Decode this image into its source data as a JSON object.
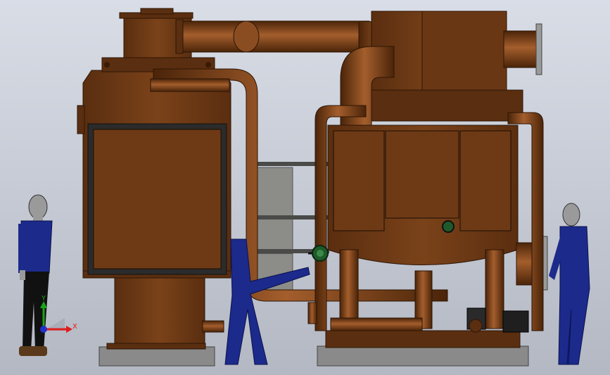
{
  "viewport": {
    "background_top": "#d9dde6",
    "background_bottom": "#b3b8c3"
  },
  "colors": {
    "equipment": "#6e3a16",
    "equipment_dark": "#3f1f08",
    "equipment_light": "#8a4d22",
    "pipe_highlight": "#a45e2c",
    "panel_frame": "#2a2a2a",
    "slab": "#8a8a8a",
    "person_blue": "#1c2a8c",
    "person_skin": "#9a9a9a",
    "person_pants": "#111111",
    "valve_green": "#1f5a2a",
    "heat_exchanger": "#8c8c88"
  },
  "coordinate_triad": {
    "icon": "xyz-axis-triad-icon",
    "x_label": "X",
    "y_label": "Y",
    "x_color": "#e01b1b",
    "y_color": "#1aa51a",
    "z_color": "#2030c8"
  }
}
